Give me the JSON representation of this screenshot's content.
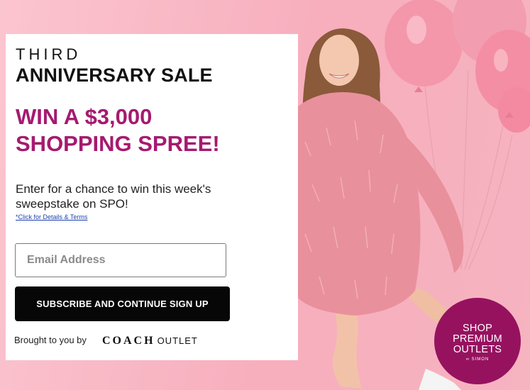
{
  "promo": {
    "eyebrow": "THIRD",
    "headline": "ANNIVERSARY SALE",
    "prize_line1": "WIN A $3,000",
    "prize_line2": "SHOPPING SPREE!",
    "description": "Enter for a chance to win this week's sweepstake on SPO!",
    "terms_link": "*Click for Details & Terms"
  },
  "form": {
    "email_placeholder": "Email Address",
    "email_value": "",
    "submit_label": "SUBSCRIBE AND CONTINUE SIGN UP"
  },
  "sponsor": {
    "prefix": "Brought to you by",
    "brand_name": "COACH",
    "brand_suffix": "OUTLET"
  },
  "badge": {
    "line1": "SHOP",
    "line2": "PREMIUM",
    "line3": "OUTLETS",
    "line4": "SIMON",
    "color": "#96125f"
  },
  "colors": {
    "accent": "#a51a70",
    "background": "#f8b8c4",
    "button": "#070707"
  }
}
